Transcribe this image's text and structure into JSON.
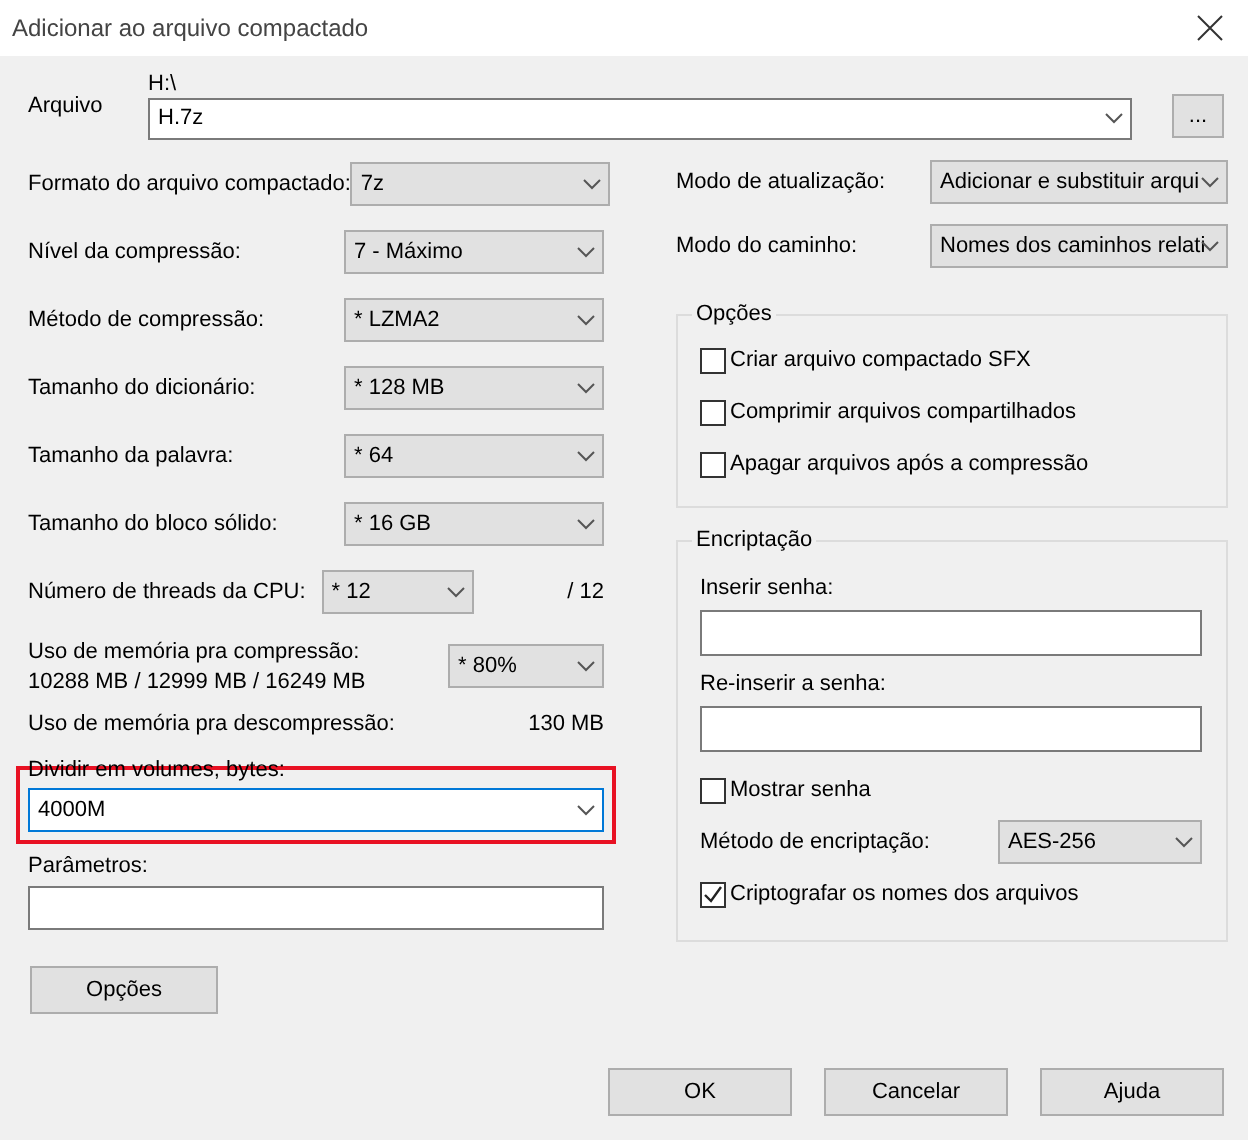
{
  "window": {
    "title": "Adicionar ao arquivo compactado"
  },
  "archive": {
    "label": "Arquivo",
    "path": "H:\\",
    "value": "H.7z",
    "browse": "..."
  },
  "settings": [
    {
      "kind": "combo",
      "label": "Formato do arquivo compactado:",
      "value": "7z"
    },
    {
      "kind": "combo",
      "label": "Nível da compressão:",
      "value": "7 - Máximo"
    },
    {
      "kind": "combo",
      "label": "Método de compressão:",
      "value": "* LZMA2"
    },
    {
      "kind": "combo",
      "label": "Tamanho do dicionário:",
      "value": "* 128 MB"
    },
    {
      "kind": "combo",
      "label": "Tamanho da palavra:",
      "value": "* 64"
    },
    {
      "kind": "combo",
      "label": "Tamanho do bloco sólido:",
      "value": "* 16 GB"
    },
    {
      "kind": "threads",
      "label": "Número de threads da CPU:",
      "value": "* 12",
      "suffix": "/ 12"
    },
    {
      "kind": "memory",
      "label": "Uso de memória pra compressão:",
      "detail": "10288 MB / 12999 MB / 16249 MB",
      "value": "* 80%"
    },
    {
      "kind": "reading",
      "label": "Uso de memória pra descompressão:",
      "value": "130 MB"
    }
  ],
  "volumes": {
    "label": "Dividir em volumes, bytes:",
    "value": "4000M",
    "highlighted": true
  },
  "parameters": {
    "label": "Parâmetros:"
  },
  "options_button": "Opções",
  "right_settings": [
    {
      "label": "Modo de atualização:",
      "value": "Adicionar e substituir arqui"
    },
    {
      "label": "Modo do caminho:",
      "value": "Nomes dos caminhos relati"
    }
  ],
  "options": {
    "title": "Opções",
    "items": [
      {
        "label": "Criar arquivo compactado SFX",
        "checked": false
      },
      {
        "label": "Comprimir arquivos compartilhados",
        "checked": false
      },
      {
        "label": "Apagar arquivos após a compressão",
        "checked": false
      }
    ]
  },
  "encryption": {
    "title": "Encriptação",
    "password_label": "Inserir senha:",
    "repeat_label": "Re-inserir a senha:",
    "show_password": {
      "label": "Mostrar senha",
      "checked": false
    },
    "method_label": "Método de encriptação:",
    "method": "AES-256",
    "encrypt_names": {
      "label": "Criptografar os nomes dos arquivos",
      "checked": true
    }
  },
  "buttons": [
    "OK",
    "Cancelar",
    "Ajuda"
  ]
}
